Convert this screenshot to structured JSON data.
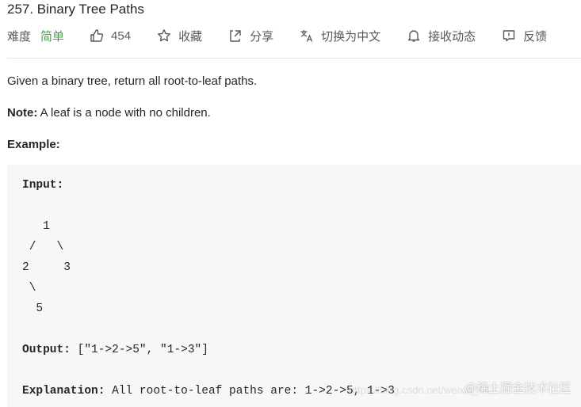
{
  "problem": {
    "title": "257. Binary Tree Paths"
  },
  "meta": {
    "difficulty_label": "难度",
    "difficulty_value": "简单",
    "likes": "454",
    "favorite": "收藏",
    "share": "分享",
    "switch_lang": "切换为中文",
    "subscribe": "接收动态",
    "feedback": "反馈",
    "icons": {
      "likes": "thumbs-up-icon",
      "favorite": "star-icon",
      "share": "share-icon",
      "switch_lang": "translate-icon",
      "subscribe": "bell-icon",
      "feedback": "comment-icon"
    }
  },
  "description": {
    "intro": "Given a binary tree, return all root-to-leaf paths.",
    "note_label": "Note:",
    "note_text": " A leaf is a node with no children.",
    "example_label": "Example:"
  },
  "example": {
    "input_label": "Input:",
    "tree_lines": [
      "   1",
      " /   \\",
      "2     3",
      " \\",
      "  5"
    ],
    "output_label": "Output:",
    "output_value": " [\"1->2->5\", \"1->3\"]",
    "explanation_label": "Explanation:",
    "explanation_text": " All root-to-leaf paths are: 1->2->5, 1->3"
  },
  "watermarks": {
    "faint": "https://blog.csdn.net/weixin_44",
    "main": "@稀土掘金技术社区"
  },
  "colors": {
    "difficulty_easy": "#43a047",
    "code_background": "#f7f7f7",
    "divider": "#e8e8e8"
  }
}
